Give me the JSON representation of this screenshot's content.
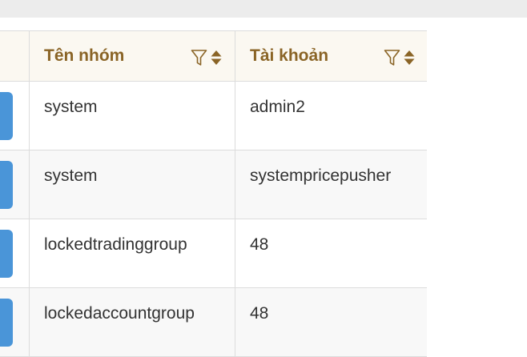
{
  "table": {
    "columns": [
      {
        "label": "Tên nhóm"
      },
      {
        "label": "Tài khoản"
      }
    ],
    "rows": [
      {
        "group": "system",
        "account": "admin2"
      },
      {
        "group": "system",
        "account": "systempricepusher"
      },
      {
        "group": "lockedtradinggroup",
        "account": "48"
      },
      {
        "group": "lockedaccountgroup",
        "account": "48"
      }
    ]
  },
  "colors": {
    "header_text": "#8a6426",
    "header_bg": "#fbf8f1",
    "action_button": "#4a95d8",
    "topbar": "#ececec"
  },
  "icons": {
    "filter": "filter-icon",
    "sort": "sort-icon"
  }
}
